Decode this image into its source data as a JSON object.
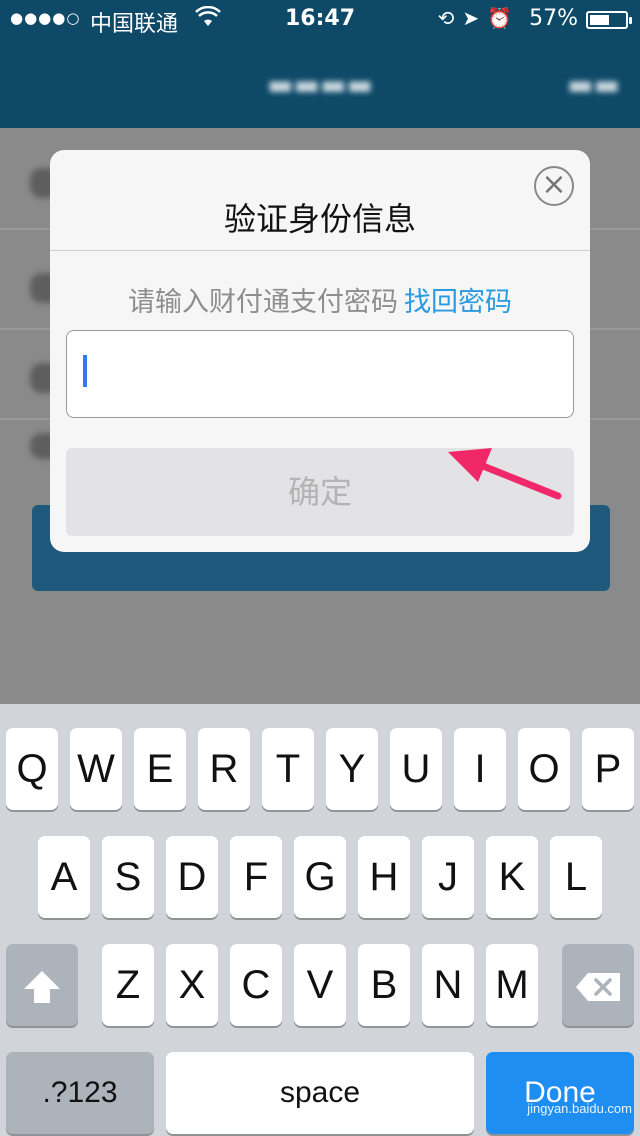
{
  "status_bar": {
    "signal": "●●●●○",
    "carrier": "中国联通",
    "time": "16:47",
    "battery_percent": "57%",
    "battery_level": 0.57,
    "icons": [
      "wifi-icon",
      "orientation-lock-icon",
      "location-icon",
      "alarm-icon",
      "battery-icon"
    ]
  },
  "dialog": {
    "title": "验证身份信息",
    "prompt": "请输入财付通支付密码",
    "recover_link": "找回密码",
    "password_value": "",
    "confirm_label": "确定",
    "close_symbol": "×"
  },
  "keyboard": {
    "row1": [
      "Q",
      "W",
      "E",
      "R",
      "T",
      "Y",
      "U",
      "I",
      "O",
      "P"
    ],
    "row2": [
      "A",
      "S",
      "D",
      "F",
      "G",
      "H",
      "J",
      "K",
      "L"
    ],
    "row3": [
      "Z",
      "X",
      "C",
      "V",
      "B",
      "N",
      "M"
    ],
    "num_label": ".?123",
    "space_label": "space",
    "done_label": "Done"
  },
  "watermark": "jingyan.baidu.com",
  "colors": {
    "accent": "#2a9be0",
    "header": "#0e4a68",
    "done_key": "#1f8ef3",
    "annotation_arrow": "#f0286a"
  }
}
